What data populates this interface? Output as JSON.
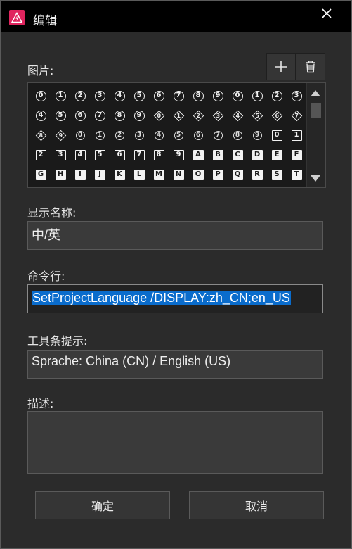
{
  "window": {
    "title": "编辑"
  },
  "images": {
    "label": "图片:",
    "add_tooltip": "+",
    "grid": [
      {
        "t": "0",
        "s": "circle"
      },
      {
        "t": "1",
        "s": "circle"
      },
      {
        "t": "2",
        "s": "circle"
      },
      {
        "t": "3",
        "s": "circle"
      },
      {
        "t": "4",
        "s": "circle"
      },
      {
        "t": "5",
        "s": "circle"
      },
      {
        "t": "6",
        "s": "circle"
      },
      {
        "t": "7",
        "s": "circle"
      },
      {
        "t": "8",
        "s": "circle"
      },
      {
        "t": "9",
        "s": "circle"
      },
      {
        "t": "0",
        "s": "circle"
      },
      {
        "t": "1",
        "s": "circle"
      },
      {
        "t": "2",
        "s": "circle"
      },
      {
        "t": "3",
        "s": "circle"
      },
      {
        "t": "4",
        "s": "circle"
      },
      {
        "t": "5",
        "s": "circle"
      },
      {
        "t": "6",
        "s": "circle"
      },
      {
        "t": "7",
        "s": "circle"
      },
      {
        "t": "8",
        "s": "circle"
      },
      {
        "t": "9",
        "s": "circle"
      },
      {
        "t": "0",
        "s": "diamond"
      },
      {
        "t": "1",
        "s": "diamond"
      },
      {
        "t": "2",
        "s": "diamond"
      },
      {
        "t": "3",
        "s": "diamond"
      },
      {
        "t": "4",
        "s": "diamond"
      },
      {
        "t": "5",
        "s": "diamond"
      },
      {
        "t": "6",
        "s": "diamond"
      },
      {
        "t": "7",
        "s": "diamond"
      },
      {
        "t": "8",
        "s": "diamond"
      },
      {
        "t": "9",
        "s": "diamond"
      },
      {
        "t": "0",
        "s": "circle-s"
      },
      {
        "t": "1",
        "s": "circle-s"
      },
      {
        "t": "2",
        "s": "circle-s"
      },
      {
        "t": "3",
        "s": "circle-s"
      },
      {
        "t": "4",
        "s": "circle-s"
      },
      {
        "t": "5",
        "s": "circle-s"
      },
      {
        "t": "6",
        "s": "circle-s"
      },
      {
        "t": "7",
        "s": "circle-s"
      },
      {
        "t": "8",
        "s": "circle-s"
      },
      {
        "t": "9",
        "s": "circle-s"
      },
      {
        "t": "0",
        "s": "square"
      },
      {
        "t": "1",
        "s": "square"
      },
      {
        "t": "2",
        "s": "square"
      },
      {
        "t": "3",
        "s": "square"
      },
      {
        "t": "4",
        "s": "square"
      },
      {
        "t": "5",
        "s": "square"
      },
      {
        "t": "6",
        "s": "square"
      },
      {
        "t": "7",
        "s": "square"
      },
      {
        "t": "8",
        "s": "square"
      },
      {
        "t": "9",
        "s": "square"
      },
      {
        "t": "A",
        "s": "filled"
      },
      {
        "t": "B",
        "s": "filled"
      },
      {
        "t": "C",
        "s": "filled"
      },
      {
        "t": "D",
        "s": "filled"
      },
      {
        "t": "E",
        "s": "filled"
      },
      {
        "t": "F",
        "s": "filled"
      },
      {
        "t": "G",
        "s": "filled"
      },
      {
        "t": "H",
        "s": "filled"
      },
      {
        "t": "I",
        "s": "filled"
      },
      {
        "t": "J",
        "s": "filled"
      },
      {
        "t": "K",
        "s": "filled"
      },
      {
        "t": "L",
        "s": "filled"
      },
      {
        "t": "M",
        "s": "filled"
      },
      {
        "t": "N",
        "s": "filled"
      },
      {
        "t": "O",
        "s": "filled"
      },
      {
        "t": "P",
        "s": "filled"
      },
      {
        "t": "Q",
        "s": "filled"
      },
      {
        "t": "R",
        "s": "filled"
      },
      {
        "t": "S",
        "s": "filled"
      },
      {
        "t": "T",
        "s": "filled"
      }
    ]
  },
  "display_name": {
    "label": "显示名称:",
    "value": "中/英"
  },
  "command_line": {
    "label": "命令行:",
    "value": "SetProjectLanguage /DISPLAY:zh_CN;en_US"
  },
  "tooltip": {
    "label": "工具条提示:",
    "value": "Sprache: China (CN) / English (US)"
  },
  "description": {
    "label": "描述:",
    "value": ""
  },
  "buttons": {
    "ok": "确定",
    "cancel": "取消"
  },
  "colors": {
    "accent_icon": "#e0245e",
    "selection": "#0a6ccc",
    "background": "#2b2b2b",
    "titlebar": "#000000"
  }
}
